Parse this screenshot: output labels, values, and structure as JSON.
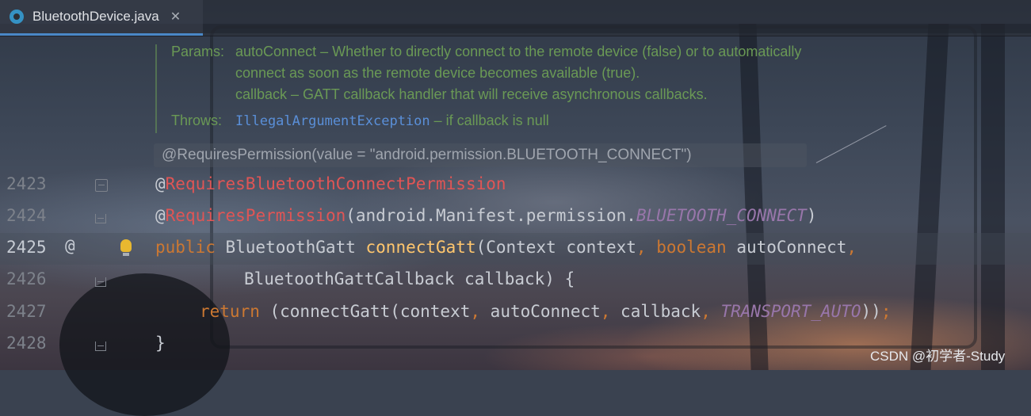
{
  "tab": {
    "icon": "class-icon",
    "label": "BluetoothDevice.java",
    "close": "✕"
  },
  "docs": {
    "params_key": "Params:",
    "param1_line1": "autoConnect – Whether to directly connect to the remote device (false) or to automatically",
    "param1_line2": "connect as soon as the remote device becomes available (true).",
    "param2_line": "callback – GATT callback handler that will receive asynchronous callbacks.",
    "throws_key": "Throws:",
    "throws_exception": "IllegalArgumentException",
    "throws_desc": " – if callback is null"
  },
  "inline_hint": "@RequiresPermission(value = \"android.permission.BLUETOOTH_CONNECT\")",
  "editor": {
    "current_line": "2425",
    "lines": [
      {
        "number": "2423"
      },
      {
        "number": "2424"
      },
      {
        "number": "2425"
      },
      {
        "number": "2426"
      },
      {
        "number": "2427"
      },
      {
        "number": "2428"
      }
    ],
    "gutter_marker": "@",
    "code": {
      "l1_at": "@",
      "l1_ann": "RequiresBluetoothConnectPermission",
      "l2_at": "@",
      "l2_ann": "RequiresPermission",
      "l2_rest": "(android.Manifest.permission.",
      "l2_const": "BLUETOOTH_CONNECT",
      "l2_close": ")",
      "l3_public": "public",
      "l3_type": " BluetoothGatt ",
      "l3_fn": "connectGatt",
      "l3_args": "(Context context",
      "l3_comma": ",",
      "l3_boolean": " boolean",
      "l3_auto": " autoConnect",
      "l3_comma2": ",",
      "l4": "BluetoothGattCallback callback) {",
      "l5_return": "return",
      "l5_a": " (connectGatt(context",
      "l5_c1": ",",
      "l5_b": " autoConnect",
      "l5_c2": ",",
      "l5_cb": " callback",
      "l5_c3": ",",
      "l5_const": " TRANSPORT_AUTO",
      "l5_close": "))",
      "l5_semi": ";",
      "l6": "}"
    }
  },
  "watermark": "CSDN @初学者-Study",
  "colors": {
    "keyword": "#cc7832",
    "annotation_error": "#e05555",
    "method": "#ffc66d",
    "constant": "#9876aa",
    "doc_text": "#6a9955",
    "doc_code": "#5a8fd8",
    "tab_accent": "#4a88c7"
  }
}
